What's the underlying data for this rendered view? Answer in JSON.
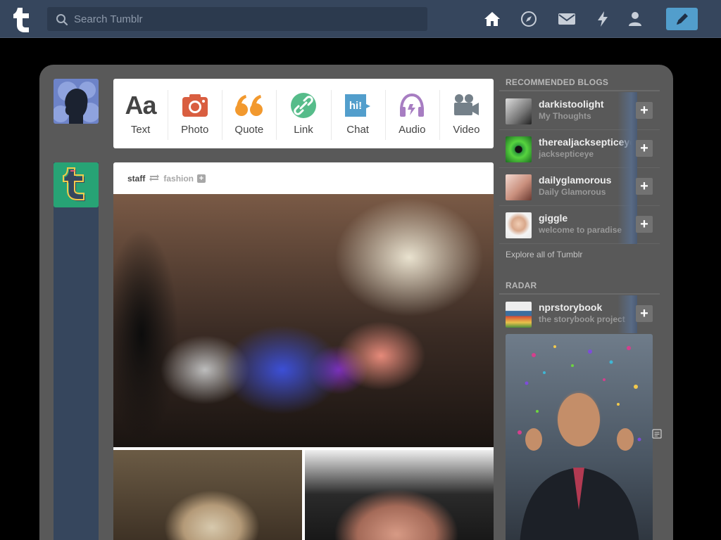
{
  "header": {
    "search_placeholder": "Search Tumblr",
    "nav": [
      "home-icon",
      "explore-icon",
      "inbox-icon",
      "activity-icon",
      "account-icon"
    ],
    "compose": "pencil-icon"
  },
  "post_types": [
    {
      "label": "Text",
      "icon": "text-icon",
      "color": "#444444"
    },
    {
      "label": "Photo",
      "icon": "camera-icon",
      "color": "#d95e40"
    },
    {
      "label": "Quote",
      "icon": "quote-icon",
      "color": "#f2992e"
    },
    {
      "label": "Link",
      "icon": "link-icon",
      "color": "#56bc8a"
    },
    {
      "label": "Chat",
      "icon": "chat-icon",
      "color": "#529ecc"
    },
    {
      "label": "Audio",
      "icon": "headphones-icon",
      "color": "#a77dc2"
    },
    {
      "label": "Video",
      "icon": "video-icon",
      "color": "#748089"
    }
  ],
  "post": {
    "author": "staff",
    "reblogged_from": "fashion"
  },
  "sidebar": {
    "recommended_heading": "RECOMMENDED BLOGS",
    "recommended": [
      {
        "name": "darkistoolight",
        "title": "My Thoughts"
      },
      {
        "name": "therealjacksepticeye",
        "title": "jacksepticeye"
      },
      {
        "name": "dailyglamorous",
        "title": "Daily Glamorous"
      },
      {
        "name": "giggle",
        "title": "welcome to paradise"
      }
    ],
    "explore": "Explore all of Tumblr",
    "radar_heading": "RADAR",
    "radar_blog": {
      "name": "nprstorybook",
      "title": "the storybook project"
    }
  }
}
